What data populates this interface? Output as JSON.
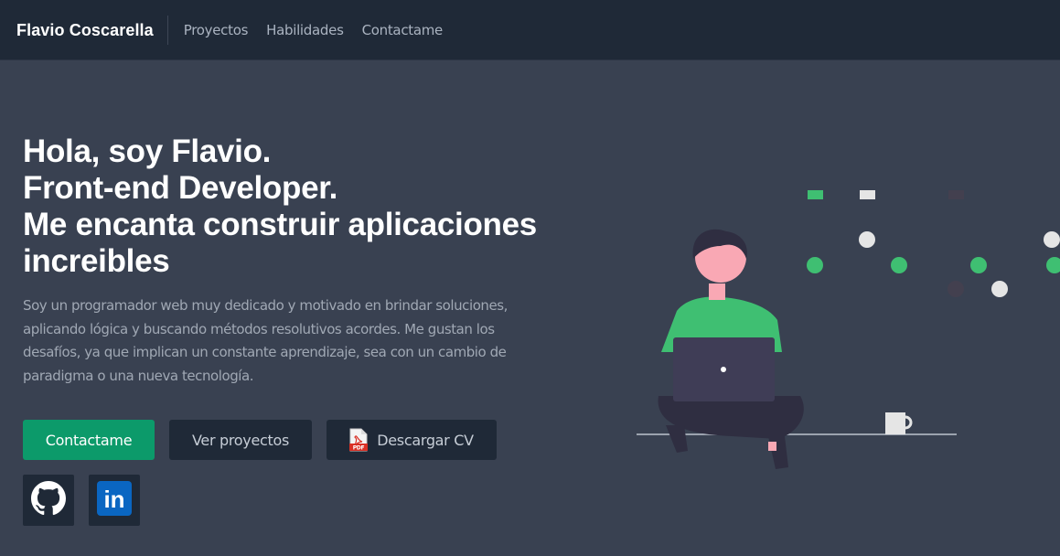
{
  "nav": {
    "brand": "Flavio Coscarella",
    "links": [
      "Proyectos",
      "Habilidades",
      "Contactame"
    ]
  },
  "hero": {
    "title_lines": [
      "Hola, soy Flavio.",
      "Front-end Developer.",
      "Me encanta construir aplicaciones",
      "increibles"
    ],
    "description": "Soy un programador web muy dedicado y motivado en brindar soluciones, aplicando lógica y buscando métodos resolutivos acordes. Me gustan los desafíos, ya que implican un constante aprendizaje, sea con un cambio de paradigma o una nueva tecnología."
  },
  "buttons": {
    "contact": "Contactame",
    "projects": "Ver proyectos",
    "cv": "Descargar CV",
    "cv_icon": "pdf-file-icon",
    "cv_icon_label": "PDF"
  },
  "social": {
    "github_icon": "github-icon",
    "linkedin_icon": "linkedin-icon",
    "linkedin_text": "in"
  },
  "colors": {
    "page_bg": "#394151",
    "navbar_bg": "#1f2937",
    "accent": "#0c9a6a",
    "illustration_green": "#3fbf72"
  }
}
